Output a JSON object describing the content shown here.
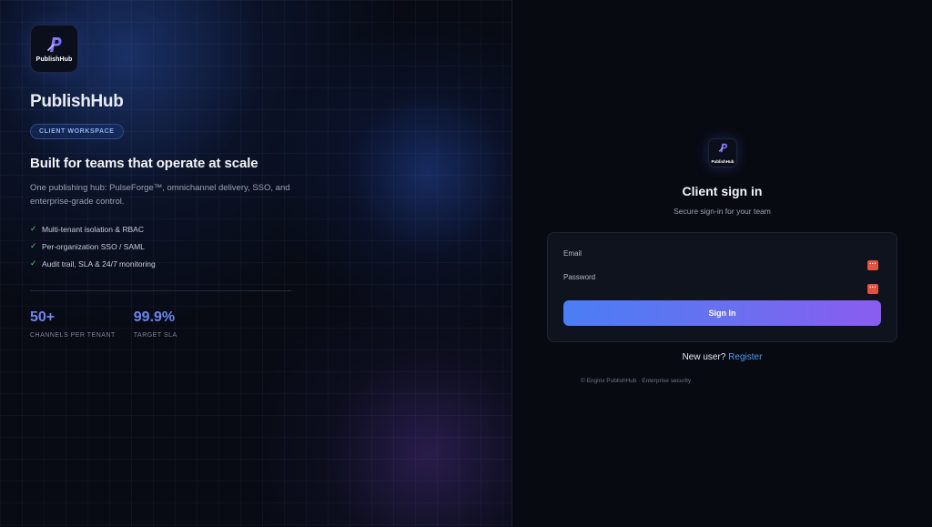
{
  "brand": {
    "logo_glyph": "P",
    "logo_text": "PublishHub",
    "name": "PublishHub",
    "badge": "CLIENT WORKSPACE",
    "accent_color": "#6c86f2"
  },
  "hero": {
    "headline": "Built for teams that operate at scale",
    "subhead": "One publishing hub: PulseForge™, omnichannel delivery, SSO, and enterprise-grade control.",
    "features": [
      {
        "icon": "check-icon",
        "check": "✓",
        "text": "Multi-tenant isolation & RBAC"
      },
      {
        "icon": "check-icon",
        "check": "✓",
        "text": "Per-organization SSO / SAML"
      },
      {
        "icon": "check-icon",
        "check": "✓",
        "text": "Audit trail, SLA & 24/7 monitoring"
      }
    ],
    "stats": [
      {
        "value": "50+",
        "label": "CHANNELS PER TENANT"
      },
      {
        "value": "99.9%",
        "label": "TARGET SLA"
      }
    ]
  },
  "auth": {
    "logo_text": "PublishHub",
    "title": "Client sign in",
    "subtitle": "Secure sign-in for your team",
    "email": {
      "label": "Email",
      "value": "",
      "placeholder": "",
      "action_icon": "password-manager-icon"
    },
    "password": {
      "label": "Password",
      "value": "",
      "placeholder": "",
      "action_icon": "password-manager-icon"
    },
    "submit_label": "Sign In",
    "register_prompt": "New user?",
    "register_link": "Register",
    "footer": "© Enginx PublishHub · Enterprise security",
    "button_gradient": [
      "#4a7ef5",
      "#8a5cf0"
    ]
  }
}
